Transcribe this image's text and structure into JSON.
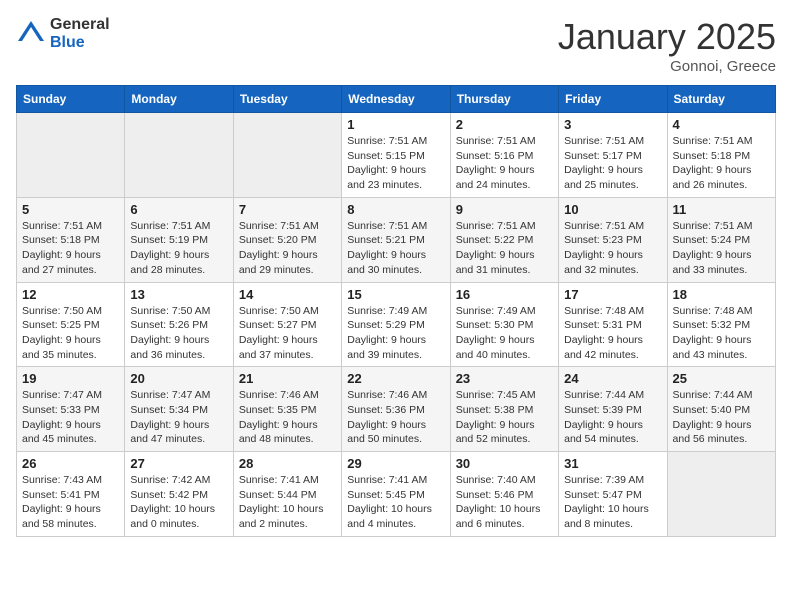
{
  "logo": {
    "general": "General",
    "blue": "Blue"
  },
  "title": "January 2025",
  "location": "Gonnoi, Greece",
  "days_header": [
    "Sunday",
    "Monday",
    "Tuesday",
    "Wednesday",
    "Thursday",
    "Friday",
    "Saturday"
  ],
  "weeks": [
    [
      {
        "day": "",
        "sunrise": "",
        "sunset": "",
        "daylight": ""
      },
      {
        "day": "",
        "sunrise": "",
        "sunset": "",
        "daylight": ""
      },
      {
        "day": "",
        "sunrise": "",
        "sunset": "",
        "daylight": ""
      },
      {
        "day": "1",
        "sunrise": "Sunrise: 7:51 AM",
        "sunset": "Sunset: 5:15 PM",
        "daylight": "Daylight: 9 hours and 23 minutes."
      },
      {
        "day": "2",
        "sunrise": "Sunrise: 7:51 AM",
        "sunset": "Sunset: 5:16 PM",
        "daylight": "Daylight: 9 hours and 24 minutes."
      },
      {
        "day": "3",
        "sunrise": "Sunrise: 7:51 AM",
        "sunset": "Sunset: 5:17 PM",
        "daylight": "Daylight: 9 hours and 25 minutes."
      },
      {
        "day": "4",
        "sunrise": "Sunrise: 7:51 AM",
        "sunset": "Sunset: 5:18 PM",
        "daylight": "Daylight: 9 hours and 26 minutes."
      }
    ],
    [
      {
        "day": "5",
        "sunrise": "Sunrise: 7:51 AM",
        "sunset": "Sunset: 5:18 PM",
        "daylight": "Daylight: 9 hours and 27 minutes."
      },
      {
        "day": "6",
        "sunrise": "Sunrise: 7:51 AM",
        "sunset": "Sunset: 5:19 PM",
        "daylight": "Daylight: 9 hours and 28 minutes."
      },
      {
        "day": "7",
        "sunrise": "Sunrise: 7:51 AM",
        "sunset": "Sunset: 5:20 PM",
        "daylight": "Daylight: 9 hours and 29 minutes."
      },
      {
        "day": "8",
        "sunrise": "Sunrise: 7:51 AM",
        "sunset": "Sunset: 5:21 PM",
        "daylight": "Daylight: 9 hours and 30 minutes."
      },
      {
        "day": "9",
        "sunrise": "Sunrise: 7:51 AM",
        "sunset": "Sunset: 5:22 PM",
        "daylight": "Daylight: 9 hours and 31 minutes."
      },
      {
        "day": "10",
        "sunrise": "Sunrise: 7:51 AM",
        "sunset": "Sunset: 5:23 PM",
        "daylight": "Daylight: 9 hours and 32 minutes."
      },
      {
        "day": "11",
        "sunrise": "Sunrise: 7:51 AM",
        "sunset": "Sunset: 5:24 PM",
        "daylight": "Daylight: 9 hours and 33 minutes."
      }
    ],
    [
      {
        "day": "12",
        "sunrise": "Sunrise: 7:50 AM",
        "sunset": "Sunset: 5:25 PM",
        "daylight": "Daylight: 9 hours and 35 minutes."
      },
      {
        "day": "13",
        "sunrise": "Sunrise: 7:50 AM",
        "sunset": "Sunset: 5:26 PM",
        "daylight": "Daylight: 9 hours and 36 minutes."
      },
      {
        "day": "14",
        "sunrise": "Sunrise: 7:50 AM",
        "sunset": "Sunset: 5:27 PM",
        "daylight": "Daylight: 9 hours and 37 minutes."
      },
      {
        "day": "15",
        "sunrise": "Sunrise: 7:49 AM",
        "sunset": "Sunset: 5:29 PM",
        "daylight": "Daylight: 9 hours and 39 minutes."
      },
      {
        "day": "16",
        "sunrise": "Sunrise: 7:49 AM",
        "sunset": "Sunset: 5:30 PM",
        "daylight": "Daylight: 9 hours and 40 minutes."
      },
      {
        "day": "17",
        "sunrise": "Sunrise: 7:48 AM",
        "sunset": "Sunset: 5:31 PM",
        "daylight": "Daylight: 9 hours and 42 minutes."
      },
      {
        "day": "18",
        "sunrise": "Sunrise: 7:48 AM",
        "sunset": "Sunset: 5:32 PM",
        "daylight": "Daylight: 9 hours and 43 minutes."
      }
    ],
    [
      {
        "day": "19",
        "sunrise": "Sunrise: 7:47 AM",
        "sunset": "Sunset: 5:33 PM",
        "daylight": "Daylight: 9 hours and 45 minutes."
      },
      {
        "day": "20",
        "sunrise": "Sunrise: 7:47 AM",
        "sunset": "Sunset: 5:34 PM",
        "daylight": "Daylight: 9 hours and 47 minutes."
      },
      {
        "day": "21",
        "sunrise": "Sunrise: 7:46 AM",
        "sunset": "Sunset: 5:35 PM",
        "daylight": "Daylight: 9 hours and 48 minutes."
      },
      {
        "day": "22",
        "sunrise": "Sunrise: 7:46 AM",
        "sunset": "Sunset: 5:36 PM",
        "daylight": "Daylight: 9 hours and 50 minutes."
      },
      {
        "day": "23",
        "sunrise": "Sunrise: 7:45 AM",
        "sunset": "Sunset: 5:38 PM",
        "daylight": "Daylight: 9 hours and 52 minutes."
      },
      {
        "day": "24",
        "sunrise": "Sunrise: 7:44 AM",
        "sunset": "Sunset: 5:39 PM",
        "daylight": "Daylight: 9 hours and 54 minutes."
      },
      {
        "day": "25",
        "sunrise": "Sunrise: 7:44 AM",
        "sunset": "Sunset: 5:40 PM",
        "daylight": "Daylight: 9 hours and 56 minutes."
      }
    ],
    [
      {
        "day": "26",
        "sunrise": "Sunrise: 7:43 AM",
        "sunset": "Sunset: 5:41 PM",
        "daylight": "Daylight: 9 hours and 58 minutes."
      },
      {
        "day": "27",
        "sunrise": "Sunrise: 7:42 AM",
        "sunset": "Sunset: 5:42 PM",
        "daylight": "Daylight: 10 hours and 0 minutes."
      },
      {
        "day": "28",
        "sunrise": "Sunrise: 7:41 AM",
        "sunset": "Sunset: 5:44 PM",
        "daylight": "Daylight: 10 hours and 2 minutes."
      },
      {
        "day": "29",
        "sunrise": "Sunrise: 7:41 AM",
        "sunset": "Sunset: 5:45 PM",
        "daylight": "Daylight: 10 hours and 4 minutes."
      },
      {
        "day": "30",
        "sunrise": "Sunrise: 7:40 AM",
        "sunset": "Sunset: 5:46 PM",
        "daylight": "Daylight: 10 hours and 6 minutes."
      },
      {
        "day": "31",
        "sunrise": "Sunrise: 7:39 AM",
        "sunset": "Sunset: 5:47 PM",
        "daylight": "Daylight: 10 hours and 8 minutes."
      },
      {
        "day": "",
        "sunrise": "",
        "sunset": "",
        "daylight": ""
      }
    ]
  ]
}
